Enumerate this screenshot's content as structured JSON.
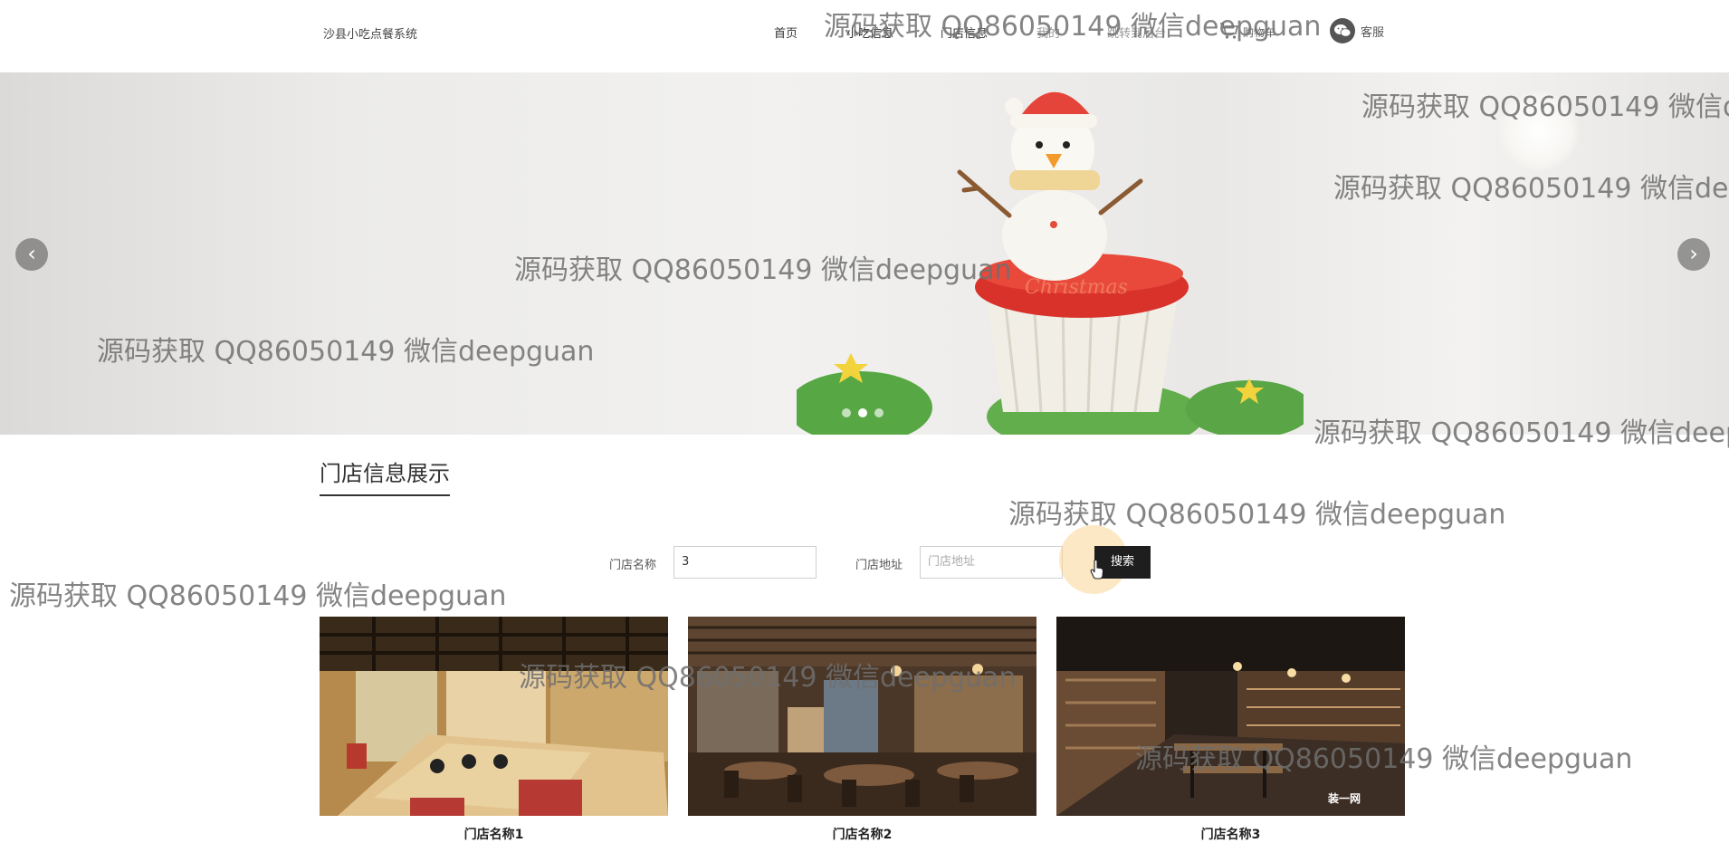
{
  "header": {
    "site_title": "沙县小吃点餐系统",
    "nav": [
      "首页",
      "小吃信息",
      "门店信息",
      "我的",
      "跳转到后台"
    ],
    "cart_label": "购物车",
    "service_label": "客服"
  },
  "banner": {
    "prev_arrow": "‹",
    "next_arrow": "›",
    "slide_count": 3,
    "active_slide": 2,
    "cake_text": "Christmas"
  },
  "section": {
    "title": "门店信息展示"
  },
  "search": {
    "name_label": "门店名称",
    "name_value": "3",
    "address_label": "门店地址",
    "address_placeholder": "门店地址",
    "button_label": "搜索"
  },
  "stores": [
    {
      "name": "门店名称1"
    },
    {
      "name": "门店名称2"
    },
    {
      "name": "门店名称3",
      "logo_text": "装一网"
    }
  ],
  "watermark": {
    "text": "源码获取 QQ86050149 微信deepguan",
    "text_cut_1": "源码获取 QQ86050149 微信d",
    "text_cut_2": "源码获取 QQ86050149 微信dee",
    "text_cut_3": "源码获取 QQ86050149 微信deep"
  },
  "icons": [
    "cart-icon",
    "wechat-icon",
    "cursor-hand-icon"
  ]
}
